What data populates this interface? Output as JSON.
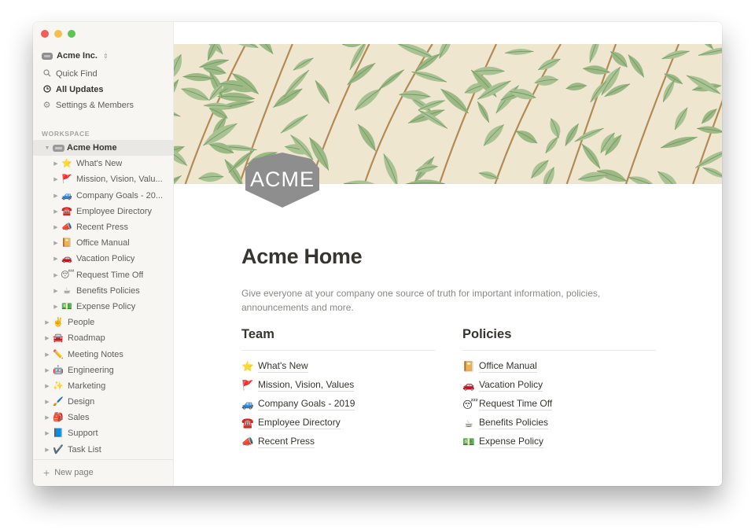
{
  "window": {
    "traffic_lights": [
      "close",
      "minimize",
      "maximize"
    ]
  },
  "sidebar": {
    "workspace_name": "Acme Inc.",
    "workspace_caret": "⌃",
    "nav": [
      {
        "label": "Quick Find",
        "icon": "search-icon",
        "glyph": "⌕"
      },
      {
        "label": "All Updates",
        "icon": "clock-icon",
        "glyph": "◷"
      },
      {
        "label": "Settings & Members",
        "icon": "gear-icon",
        "glyph": "⚙"
      }
    ],
    "section_label": "WORKSPACE",
    "tree": [
      {
        "label": "Acme Home",
        "emoji": "",
        "level": 0,
        "expanded": true,
        "selected": true
      },
      {
        "label": "What's New",
        "emoji": "⭐",
        "level": 1
      },
      {
        "label": "Mission, Vision, Valu...",
        "emoji": "🚩",
        "level": 1
      },
      {
        "label": "Company Goals - 20...",
        "emoji": "🚙",
        "level": 1
      },
      {
        "label": "Employee Directory",
        "emoji": "☎️",
        "level": 1
      },
      {
        "label": "Recent Press",
        "emoji": "📣",
        "level": 1
      },
      {
        "label": "Office Manual",
        "emoji": "📔",
        "level": 1
      },
      {
        "label": "Vacation Policy",
        "emoji": "🚗",
        "level": 1
      },
      {
        "label": "Request Time Off",
        "emoji": "😴",
        "level": 1
      },
      {
        "label": "Benefits Policies",
        "emoji": "☕",
        "level": 1
      },
      {
        "label": "Expense Policy",
        "emoji": "💵",
        "level": 1
      },
      {
        "label": "People",
        "emoji": "✌️",
        "level": 0
      },
      {
        "label": "Roadmap",
        "emoji": "🚘",
        "level": 0
      },
      {
        "label": "Meeting Notes",
        "emoji": "✏️",
        "level": 0
      },
      {
        "label": "Engineering",
        "emoji": "🤖",
        "level": 0
      },
      {
        "label": "Marketing",
        "emoji": "✨",
        "level": 0
      },
      {
        "label": "Design",
        "emoji": "🖌️",
        "level": 0
      },
      {
        "label": "Sales",
        "emoji": "🎒",
        "level": 0
      },
      {
        "label": "Support",
        "emoji": "📘",
        "level": 0
      },
      {
        "label": "Task List",
        "emoji": "✔️",
        "level": 0
      }
    ],
    "new_page_label": "New page"
  },
  "page": {
    "icon_text": "ACME",
    "title": "Acme Home",
    "description": "Give everyone at your company one source of truth for important information, policies, announcements and more.",
    "columns": [
      {
        "heading": "Team",
        "links": [
          {
            "emoji": "⭐",
            "label": "What's New"
          },
          {
            "emoji": "🚩",
            "label": "Mission, Vision, Values"
          },
          {
            "emoji": "🚙",
            "label": "Company Goals - 2019"
          },
          {
            "emoji": "☎️",
            "label": "Employee Directory"
          },
          {
            "emoji": "📣",
            "label": "Recent Press"
          }
        ]
      },
      {
        "heading": "Policies",
        "links": [
          {
            "emoji": "📔",
            "label": "Office Manual"
          },
          {
            "emoji": "🚗",
            "label": "Vacation Policy"
          },
          {
            "emoji": "😴",
            "label": "Request Time Off"
          },
          {
            "emoji": "☕",
            "label": "Benefits Policies"
          },
          {
            "emoji": "💵",
            "label": "Expense Policy"
          }
        ]
      }
    ]
  },
  "colors": {
    "sidebar_bg": "#f7f6f3",
    "text_primary": "#37352f",
    "text_secondary": "#8a8985",
    "cover_bg": "#efe6d0",
    "leaf_green": "#9cb985",
    "leaf_dark": "#6f9a63",
    "stem_brown": "#b28a55",
    "logo_gray": "#8e8e8e"
  }
}
